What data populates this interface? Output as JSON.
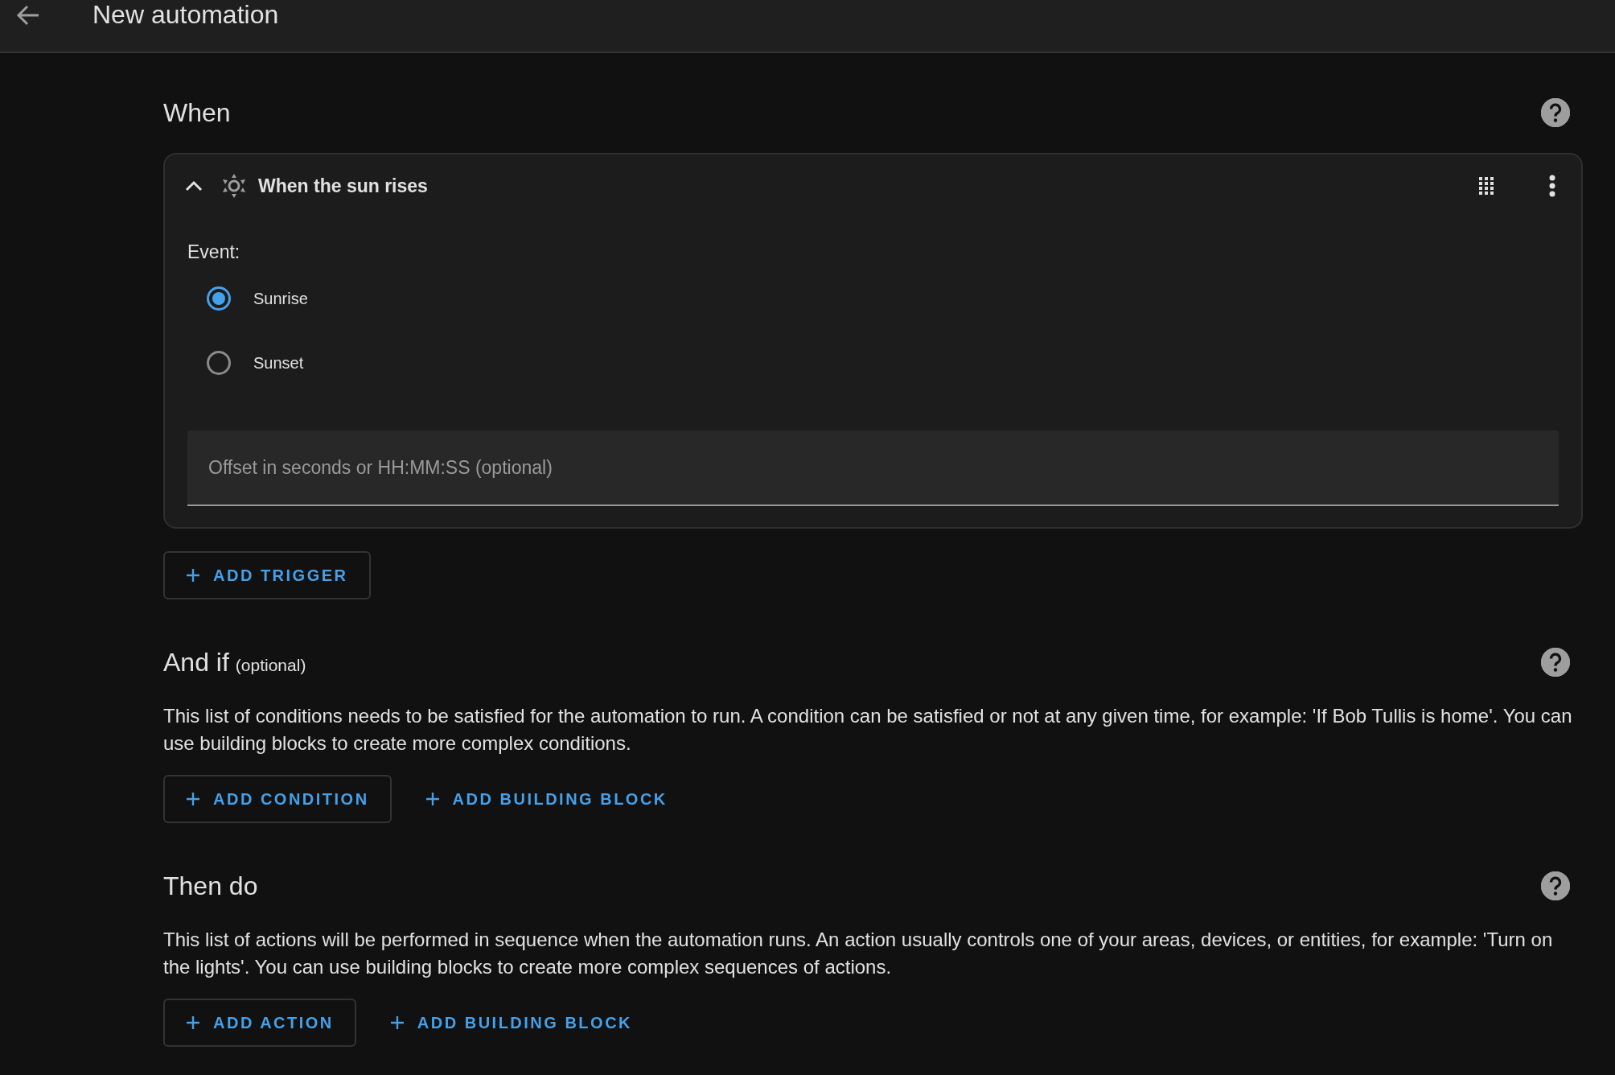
{
  "header": {
    "title": "New automation"
  },
  "sections": [
    {
      "title": "When",
      "trigger": {
        "title": "When the sun rises",
        "expanded": true,
        "event_label": "Event:",
        "options": [
          {
            "label": "Sunrise",
            "selected": true
          },
          {
            "label": "Sunset",
            "selected": false
          }
        ],
        "offset": {
          "placeholder": "Offset in seconds or HH:MM:SS (optional)"
        }
      },
      "buttons": [
        {
          "label": "ADD TRIGGER",
          "kind": "outlined"
        }
      ]
    },
    {
      "title": "And if",
      "subtitle": "(optional)",
      "description": "This list of conditions needs to be satisfied for the automation to run. A condition can be satisfied or not at any given time, for example: 'If Bob Tullis is home'. You can use building blocks to create more complex conditions.",
      "buttons": [
        {
          "label": "ADD CONDITION",
          "kind": "outlined"
        },
        {
          "label": "ADD BUILDING BLOCK",
          "kind": "text"
        }
      ]
    },
    {
      "title": "Then do",
      "description": "This list of actions will be performed in sequence when the automation runs. An action usually controls one of your areas, devices, or entities, for example: 'Turn on the lights'. You can use building blocks to create more complex sequences of actions.",
      "buttons": [
        {
          "label": "ADD ACTION",
          "kind": "outlined"
        },
        {
          "label": "ADD BUILDING BLOCK",
          "kind": "text"
        }
      ]
    }
  ]
}
